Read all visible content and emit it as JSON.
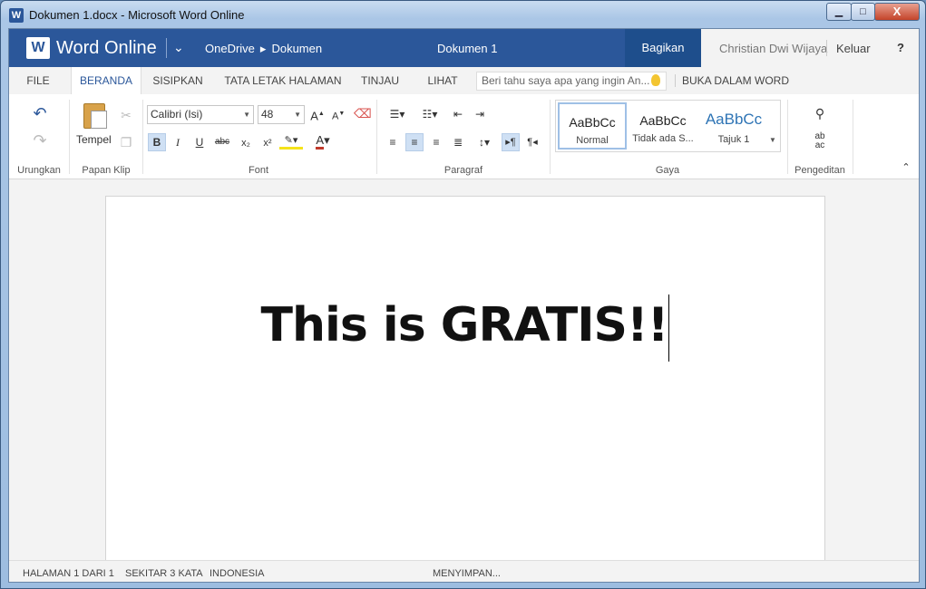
{
  "window": {
    "title": "Dokumen 1.docx - Microsoft Word Online",
    "icon": "word-icon",
    "close_label": "X"
  },
  "app": {
    "name": "Word Online",
    "breadcrumb": [
      "OneDrive",
      "Dokumen"
    ],
    "doc_title": "Dokumen 1",
    "share_label": "Bagikan",
    "user": "Christian Dwi Wijaya",
    "logout": "Keluar",
    "help": "?",
    "brand_color": "#2b579a"
  },
  "tabs": [
    "FILE",
    "BERANDA",
    "SISIPKAN",
    "TATA LETAK HALAMAN",
    "TINJAU",
    "LIHAT"
  ],
  "active_tab": "BERANDA",
  "tellme_placeholder": "Beri tahu saya apa yang ingin An...",
  "open_in_word": "BUKA DALAM WORD",
  "ribbon": {
    "groups": [
      "Urungkan",
      "Papan Klip",
      "Font",
      "Paragraf",
      "Gaya",
      "Pengeditan"
    ],
    "paste_label": "Tempel",
    "font_name": "Calibri (Isi)",
    "font_size": "48",
    "format_glyphs": {
      "bold": "B",
      "italic": "I",
      "underline": "U",
      "strike": "abc",
      "sub": "x₂",
      "sup": "x²",
      "font_color": "A"
    },
    "styles": [
      {
        "preview": "AaBbCc",
        "name": "Normal"
      },
      {
        "preview": "AaBbCc",
        "name": "Tidak ada S..."
      },
      {
        "preview": "AaBbCc",
        "name": "Tajuk 1"
      }
    ]
  },
  "document": {
    "text": "This is GRATIS!!"
  },
  "status": {
    "page": "HALAMAN 1 DARI 1",
    "words": "SEKITAR 3 KATA",
    "language": "INDONESIA",
    "saving": "MENYIMPAN..."
  }
}
